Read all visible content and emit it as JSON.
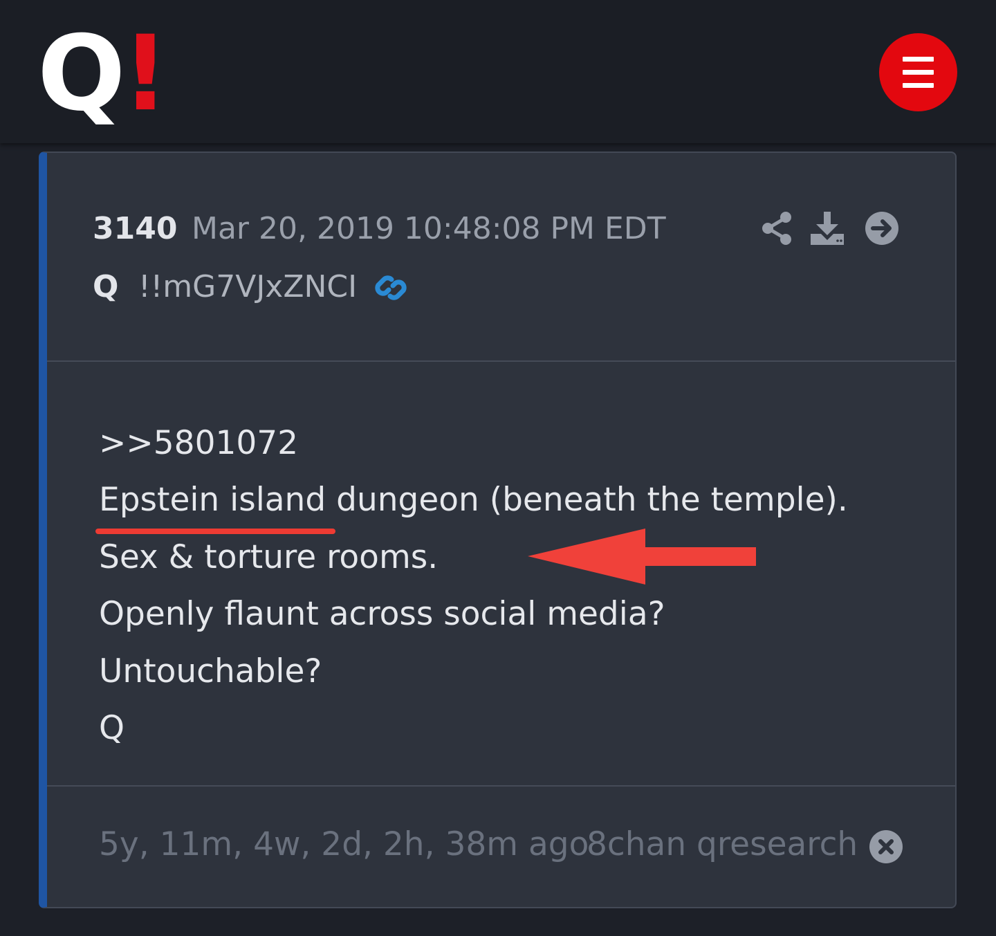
{
  "logo": {
    "letter": "Q",
    "mark": "!",
    "brand_color": "#e0101b"
  },
  "menu": {
    "icon": "hamburger-menu-icon",
    "color": "#e3080f"
  },
  "post": {
    "number": "3140",
    "date": "Mar 20, 2019 10:48:08 PM EDT",
    "author": "Q",
    "tripcode": "!!mG7VJxZNCI",
    "actions": [
      "share-icon",
      "download-icon",
      "arrow-right-circle-icon"
    ],
    "lines": [
      ">>5801072",
      "Epstein island dungeon (beneath the temple).",
      "Sex & torture rooms.",
      "Openly flaunt across social media?",
      "Untouchable?",
      "Q"
    ],
    "relative_time": "5y, 11m, 4w, 2d, 2h, 38m ago",
    "source": "8chan qresearch"
  },
  "colors": {
    "accent_bar": "#1f55a3",
    "link_icon": "#2a8ad4",
    "annotation_red": "#ee3b33"
  }
}
